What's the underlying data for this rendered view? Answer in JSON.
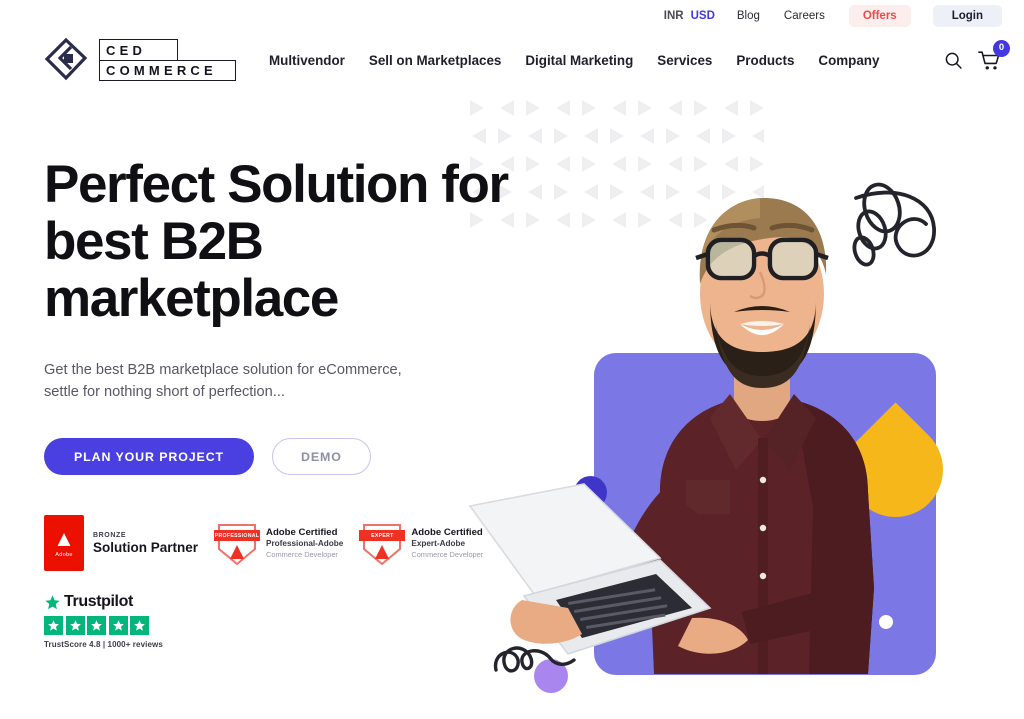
{
  "topbar": {
    "currency": {
      "inactive": "INR",
      "active": "USD"
    },
    "links": [
      "Blog",
      "Careers"
    ],
    "offers_label": "Offers",
    "login_label": "Login",
    "offers_color": "#eb4a4a",
    "active_currency_color": "#4338e0"
  },
  "header": {
    "logo": {
      "line1": "CED",
      "line2": "COMMERCE",
      "mark": "ced-diamond-monogram"
    },
    "nav": [
      "Multivendor",
      "Sell on Marketplaces",
      "Digital Marketing",
      "Services",
      "Products",
      "Company"
    ],
    "search_icon": "search-icon",
    "cart_icon": "cart-icon",
    "cart_count": "0",
    "cart_badge_color": "#4338e0"
  },
  "hero": {
    "title_line1": "Perfect Solution for",
    "title_line2": "best B2B",
    "title_line3": "marketplace",
    "subtitle_line1": "Get the best B2B marketplace solution for eCommerce,",
    "subtitle_line2": "settle for nothing short of perfection...",
    "primary_cta": "PLAN YOUR PROJECT",
    "secondary_cta": "DEMO",
    "primary_color": "#4a3fe0",
    "art": {
      "panel_color": "#7b78e5",
      "accent_yellow": "#f5b719",
      "dot_indigo": "#3f35c8",
      "dot_violet": "#a985ee",
      "photo_subject": "smiling-bearded-man-with-glasses-holding-laptop"
    }
  },
  "badges": {
    "adobe_partner": {
      "brand": "Adobe",
      "tier": "BRONZE",
      "title": "Solution Partner",
      "color": "#eb1000"
    },
    "certifications": [
      {
        "ribbon": "PROFESSIONAL",
        "line1": "Adobe Certified",
        "line2": "Professional-Adobe",
        "line3": "Commerce Developer"
      },
      {
        "ribbon": "EXPERT",
        "line1": "Adobe Certified",
        "line2": "Expert-Adobe",
        "line3": "Commerce Developer"
      }
    ]
  },
  "trustpilot": {
    "name": "Trustpilot",
    "stars": 5,
    "star_color": "#00b67a",
    "score_text": "TrustScore 4.8 | 1000+ reviews"
  }
}
